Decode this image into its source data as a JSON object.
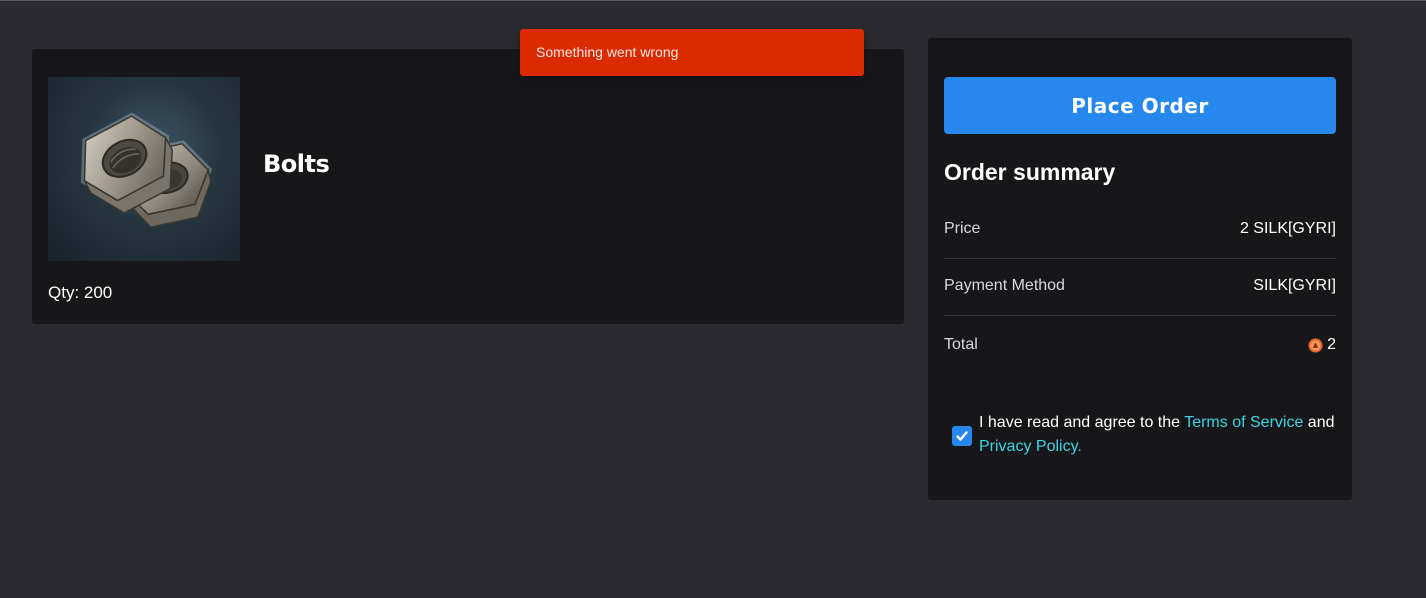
{
  "toast": {
    "message": "Something went wrong",
    "color": "#dc2a00"
  },
  "product": {
    "name": "Bolts",
    "image_icon": "hex-nuts-icon",
    "qty_label": "Qty: 200"
  },
  "order": {
    "place_order_label": "Place Order",
    "summary_title": "Order summary",
    "rows": [
      {
        "label": "Price",
        "value": "2 SILK[GYRI]"
      },
      {
        "label": "Payment Method",
        "value": "SILK[GYRI]"
      },
      {
        "label": "Total",
        "value": "2",
        "icon": "silk-coin-icon"
      }
    ],
    "agree": {
      "checked": true,
      "text_before": "I have read and agree to the ",
      "terms_link": "Terms of Service",
      "text_middle": " and",
      "privacy_link": "Privacy Policy."
    }
  },
  "colors": {
    "accent": "#2688ec",
    "link": "#3ed3e6",
    "background": "#2b2a30",
    "panel": "#17171a",
    "error": "#dc2a00"
  }
}
